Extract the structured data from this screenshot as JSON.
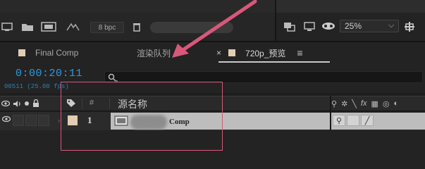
{
  "toolbar": {
    "bpc_label": "8 bpc",
    "zoom_value": "25%"
  },
  "tabs": [
    {
      "label": "Final Comp",
      "active": false
    },
    {
      "label": "渲染队列",
      "active": false
    },
    {
      "label": "720p_预览",
      "active": true
    }
  ],
  "timeline": {
    "timecode": "0:00:20:11",
    "frame_info": "00511 (25.00 fps)",
    "search_value": ""
  },
  "columns": {
    "number_header": "#",
    "source_name_header": "源名称",
    "switches_header_icons": [
      "shy-icon",
      "collapse-icon",
      "quality-icon",
      "fx-icon",
      "frame-blend-icon",
      "motion-blur-icon",
      "adjustment-icon"
    ]
  },
  "layers": [
    {
      "index": "1",
      "name": "Comp",
      "label_color": "#e2cdb2"
    }
  ],
  "colors": {
    "timecode": "#2e9be0",
    "label_swatch": "#e2cdb2",
    "annotation": "#d8587a"
  }
}
